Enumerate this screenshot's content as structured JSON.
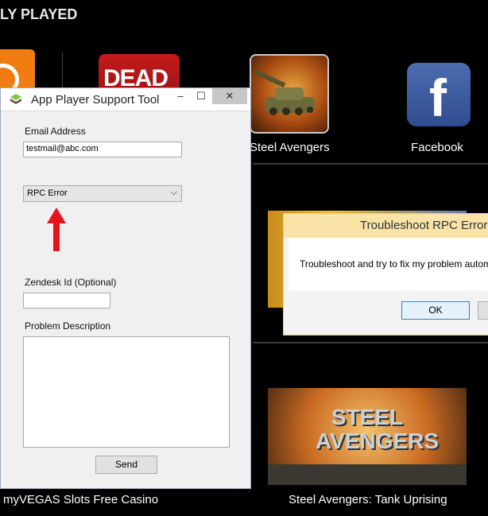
{
  "launcher": {
    "section_title": "LY PLAYED",
    "apps": [
      {
        "label": "Steel Avengers"
      },
      {
        "label": "Facebook"
      }
    ],
    "bottom_labels": [
      "myVEGAS Slots Free Casino",
      "Steel Avengers: Tank Uprising"
    ],
    "dead_tile_text": "DEAD",
    "banner_text": "STEEL AVENGERS"
  },
  "support_tool": {
    "title": "App Player Support Tool",
    "minimize": "–",
    "maximize": "☐",
    "close": "✕",
    "email_label": "Email Address",
    "email_value": "testmail@abc.com",
    "issue_selected": "RPC Error",
    "zendesk_label": "Zendesk Id (Optional)",
    "zendesk_value": "",
    "problem_label": "Problem Description",
    "problem_value": "",
    "send_label": "Send"
  },
  "rpc_dialog": {
    "title": "Troubleshoot RPC Error",
    "message": "Troubleshoot and try to fix my problem automatically",
    "ok_label": "OK"
  },
  "colors": {
    "arrow": "#e8141b",
    "facebook": "#3b5998",
    "dialog_title_bg": "#f9e3a7"
  }
}
